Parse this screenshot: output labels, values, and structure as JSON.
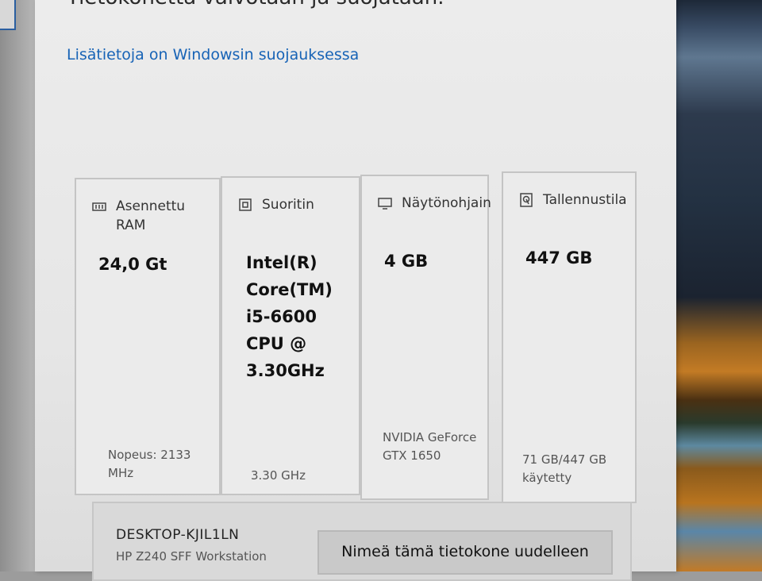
{
  "header": {
    "title": "Tietokonetta valvotaan ja suojataan.",
    "link": "Lisätietoja on Windowsin suojauksessa"
  },
  "specs": [
    {
      "icon": "ram-icon",
      "title": "Asennettu RAM",
      "value": "24,0 Gt",
      "sub": "Nopeus: 2133 MHz"
    },
    {
      "icon": "cpu-icon",
      "title": "Suoritin",
      "value": "Intel(R) Core(TM) i5-6600 CPU @ 3.30GHz",
      "sub": "3.30 GHz"
    },
    {
      "icon": "monitor-icon",
      "title": "Näytönohjain",
      "value": "4 GB",
      "sub": "NVIDIA GeForce GTX 1650"
    },
    {
      "icon": "storage-icon",
      "title": "Tallennustila",
      "value": "447 GB",
      "sub": "71 GB/447 GB käytetty"
    }
  ],
  "device": {
    "name": "DESKTOP-KJIL1LN",
    "model": "HP Z240 SFF Workstation",
    "rename_label": "Nimeä tämä tietokone uudelleen"
  },
  "colors": {
    "link": "#1763b6",
    "window": "#ececec"
  }
}
